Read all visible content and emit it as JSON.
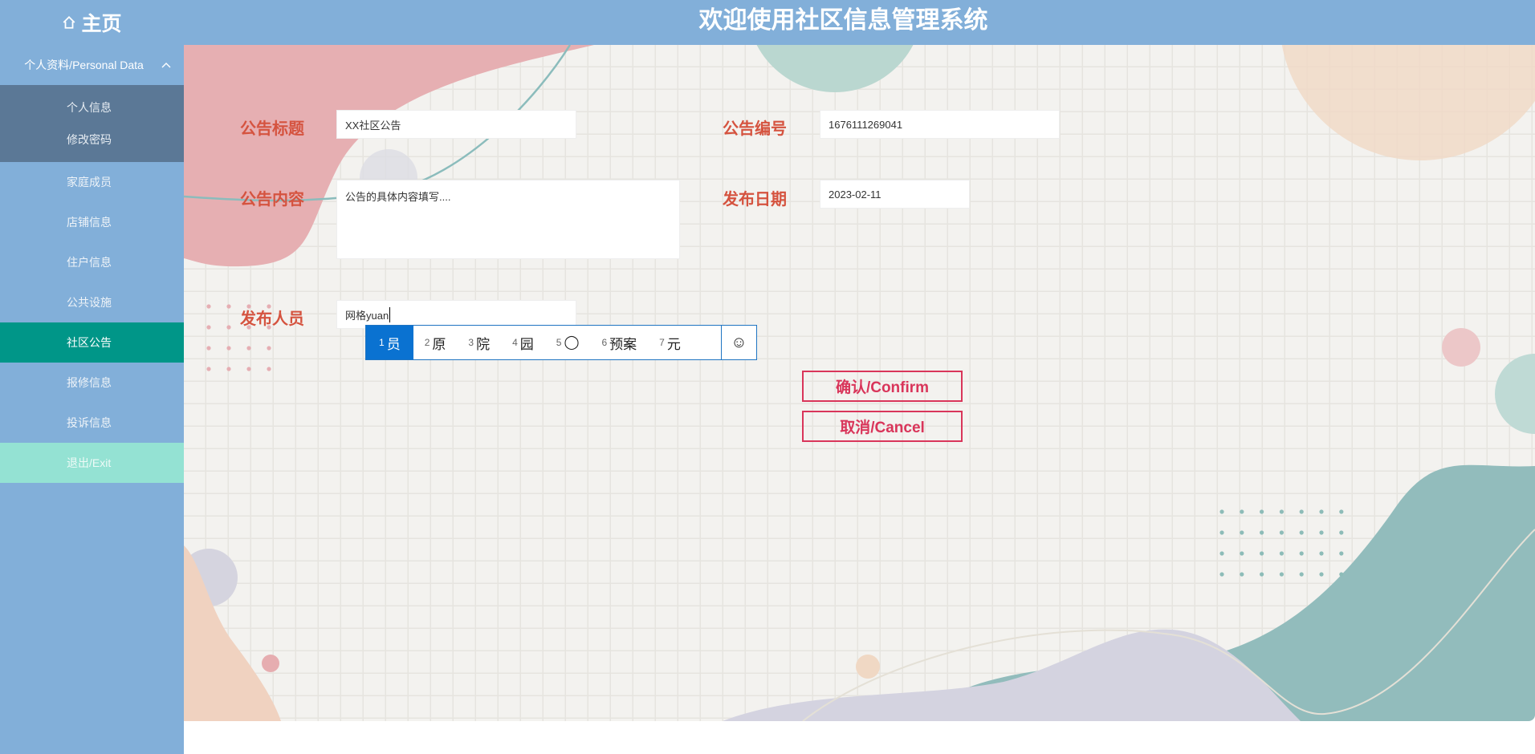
{
  "header": {
    "home_label": "主页",
    "title": "欢迎使用社区信息管理系统"
  },
  "sidebar": {
    "group_label": "个人资料/Personal Data",
    "sub_items": [
      "个人信息",
      "修改密码"
    ],
    "items": [
      "家庭成员",
      "店铺信息",
      "住户信息",
      "公共设施",
      "社区公告",
      "报修信息",
      "投诉信息"
    ],
    "active": "社区公告",
    "exit_label": "退出/Exit"
  },
  "form": {
    "title_label": "公告标题",
    "title_value": "XX社区公告",
    "number_label": "公告编号",
    "number_value": "1676111269041",
    "content_label": "公告内容",
    "content_value": "公告的具体内容填写....",
    "date_label": "发布日期",
    "date_value": "2023-02-11",
    "publisher_label": "发布人员",
    "publisher_value": "网格yuan",
    "confirm_label": "确认/Confirm",
    "cancel_label": "取消/Cancel"
  },
  "ime": {
    "candidates": [
      {
        "n": "1",
        "t": "员"
      },
      {
        "n": "2",
        "t": "原"
      },
      {
        "n": "3",
        "t": "院"
      },
      {
        "n": "4",
        "t": "园"
      },
      {
        "n": "5",
        "t": "◯"
      },
      {
        "n": "6",
        "t": "预案"
      },
      {
        "n": "7",
        "t": "元"
      }
    ],
    "emoji": "☺"
  },
  "colors": {
    "header": "#82afd9",
    "active": "#009688",
    "label": "#d5533f",
    "button": "#d9355a"
  }
}
